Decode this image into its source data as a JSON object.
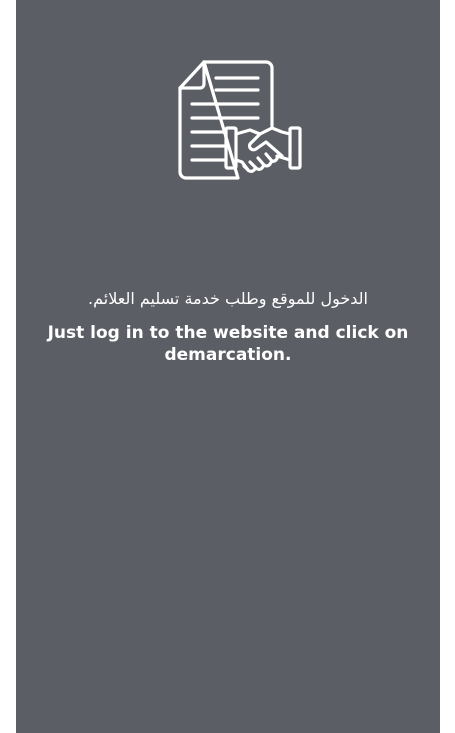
{
  "slide": {
    "icon": "contract-handshake-icon",
    "arabic_text": "الدخول للموقع وطلب خدمة تسليم العلائم.",
    "english_text": "Just log in to the website and click on demarcation.",
    "background_color": "#5c5e65",
    "text_color": "#ffffff"
  }
}
